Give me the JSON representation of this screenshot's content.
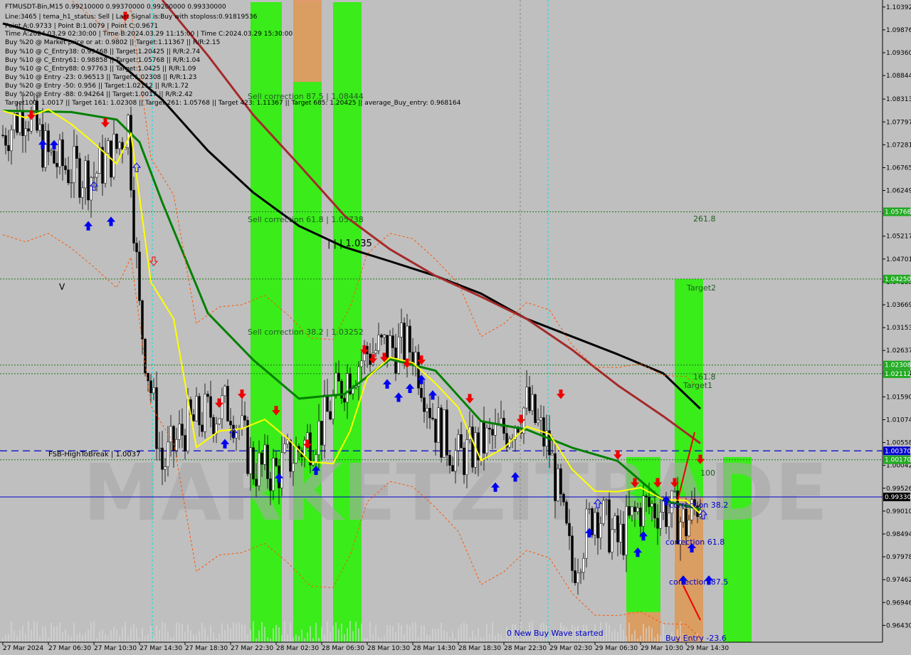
{
  "symbol_header": "FTMUSDT-Bin,M15  0.99210000 0.99370000 0.99200000 0.99330000",
  "info_lines": [
    "Line:3465 | tema_h1_status: Sell | Last Signal is:Buy with stoploss:0.91819536",
    "Point A:0.9733 | Point B:1.0079 | Point C:0.9671",
    "Time A:2024.03.29 02:30:00 | Time B:2024.03.29 11:15:00 | Time C:2024.03.29 15:30:00",
    "Buy %20 @ Market price or at: 0.9802 || Target:1.11367 || R/R:2.15",
    "Buy %10 @ C_Entry38: 0.99468 || Target:1.20425 || R/R:2.74",
    "Buy %10 @ C_Entry61: 0.98858 || Target:1.05768 || R/R:1.04",
    "Buy %10 @ C_Entry88: 0.97763 || Target:1.0425 || R/R:1.09",
    "Buy %10 @ Entry -23: 0.96513 || Target:1.02308 || R/R:1.23",
    "Buy %20 @ Entry -50: 0.956 || Target:1.02112 || R/R:1.72",
    "Buy %20 @ Entry -88: 0.94264 || Target:1.0017 || R/R:2.42",
    "Target100: 1.0017 || Target 161: 1.02308 || Target 261: 1.05768 || Target 423: 1.11367 || Target 685: 1.20425 || average_Buy_entry: 0.968164"
  ],
  "watermark": "MARKETZITRADE",
  "colors": {
    "background": "#bfbfbf",
    "green_zone": "#33ee11",
    "orange_zone": "#e39966",
    "ema_black": "#000000",
    "ema_brown": "#a52a2a",
    "ema_green": "#008000",
    "line_yellow": "#ffff00",
    "envelope_orange": "#ff5500",
    "level_green": "#1a7a1a",
    "level_blue": "#0000cc",
    "arrow_blue": "#0000ee",
    "arrow_red": "#ee0000",
    "tag_green": "#22aa22",
    "tag_blue": "#0000cc",
    "tag_black": "#000000",
    "cyan_line": "#00e5e5"
  },
  "annotations": {
    "sell_875": "Sell correction 87.5 | 1.08444",
    "sell_618": "Sell correction 61.8 | 1.05738",
    "sell_382": "Sell correction 38.2 | 1.03252",
    "level_1035": "| | | 1.035",
    "fib_2618": "261.8",
    "target2": "Target2",
    "fib_1618": "161.8",
    "target1": "Target1",
    "fsb": "FSB-HighToBreak | 1.0037",
    "fib_100": "100",
    "corr_382": "correction 38.2",
    "corr_618": "correction 61.8",
    "corr_875": "correction 87.5",
    "new_wave": "0 New Buy Wave started",
    "buy_entry": "Buy Entry -23.6",
    "v_mark": "V"
  },
  "chart_data": {
    "type": "candlestick",
    "title": "FTMUSDT-Bin,M15",
    "ylim": [
      0.9605,
      1.1055
    ],
    "yaxis_ticks": [
      "1.10392",
      "1.09876",
      "1.09360",
      "1.08844",
      "1.08313",
      "1.07797",
      "1.07281",
      "1.06765",
      "1.06249",
      "1.05733",
      "1.05217",
      "1.04701",
      "1.04185",
      "1.03669",
      "1.03153",
      "1.02637",
      "1.02121",
      "1.01590",
      "1.01074",
      "1.00558",
      "1.00042",
      "0.99526",
      "0.99010",
      "0.98494",
      "0.97978",
      "0.97462",
      "0.96946",
      "0.96430"
    ],
    "xaxis_ticks": [
      "27 Mar 2024",
      "27 Mar 06:30",
      "27 Mar 10:30",
      "27 Mar 14:30",
      "27 Mar 18:30",
      "27 Mar 22:30",
      "28 Mar 02:30",
      "28 Mar 06:30",
      "28 Mar 10:30",
      "28 Mar 14:30",
      "28 Mar 18:30",
      "28 Mar 22:30",
      "29 Mar 02:30",
      "29 Mar 06:30",
      "29 Mar 10:30",
      "29 Mar 14:30"
    ],
    "price_tags": [
      {
        "label": "1.05768",
        "value": 1.05768,
        "color": "green"
      },
      {
        "label": "1.04250",
        "value": 1.0425,
        "color": "green"
      },
      {
        "label": "1.02308",
        "value": 1.02308,
        "color": "green"
      },
      {
        "label": "1.02112",
        "value": 1.02112,
        "color": "green"
      },
      {
        "label": "1.00370",
        "value": 1.0037,
        "color": "blue"
      },
      {
        "label": "1.00170",
        "value": 1.0017,
        "color": "green"
      },
      {
        "label": "0.99330",
        "value": 0.9933,
        "color": "black"
      }
    ],
    "horizontal_levels": [
      {
        "value": 1.05768,
        "style": "dotted",
        "color": "green"
      },
      {
        "value": 1.0425,
        "style": "dotted",
        "color": "green"
      },
      {
        "value": 1.02308,
        "style": "dotted",
        "color": "green"
      },
      {
        "value": 1.02112,
        "style": "dotted",
        "color": "green"
      },
      {
        "value": 1.0037,
        "style": "dashed",
        "color": "blue"
      },
      {
        "value": 1.0017,
        "style": "dotted",
        "color": "green"
      },
      {
        "value": 0.9933,
        "style": "solid",
        "color": "blue"
      }
    ],
    "zones": [
      {
        "x_start": "27 Mar 21:45",
        "x_end": "28 Mar 00:30",
        "color": "green"
      },
      {
        "x_start": "28 Mar 01:30",
        "x_end": "28 Mar 04:00",
        "color": "green"
      },
      {
        "x_start": "28 Mar 05:00",
        "x_end": "28 Mar 07:30",
        "color": "green"
      },
      {
        "x_start": "28 Mar 01:30",
        "x_end": "28 Mar 04:00",
        "color": "orange",
        "top": 1.1055,
        "bottom": 1.087
      },
      {
        "x_start": "29 Mar 06:45",
        "x_end": "29 Mar 09:45",
        "color": "green",
        "top": 1.0023,
        "bottom": 0.9605
      },
      {
        "x_start": "29 Mar 06:45",
        "x_end": "29 Mar 09:45",
        "color": "orange",
        "top": 0.9673,
        "bottom": 0.9605
      },
      {
        "x_start": "29 Mar 11:00",
        "x_end": "29 Mar 13:30",
        "color": "green",
        "top": 1.0425,
        "bottom": 0.9605
      },
      {
        "x_start": "29 Mar 11:00",
        "x_end": "29 Mar 13:30",
        "color": "orange",
        "top": 0.9933,
        "bottom": 0.9605
      },
      {
        "x_start": "29 Mar 15:15",
        "x_end": "29 Mar 17:45",
        "color": "green",
        "top": 1.0023,
        "bottom": 0.9605
      }
    ],
    "series": [
      {
        "name": "ema_black",
        "color": "black",
        "points": [
          [
            "27 Mar 00:00",
            1.1002
          ],
          [
            "27 Mar 06:00",
            1.0962
          ],
          [
            "27 Mar 10:00",
            1.0918
          ],
          [
            "27 Mar 14:00",
            1.083
          ],
          [
            "27 Mar 18:00",
            1.0715
          ],
          [
            "27 Mar 22:00",
            1.062
          ],
          [
            "28 Mar 02:00",
            1.0545
          ],
          [
            "28 Mar 06:00",
            1.0497
          ],
          [
            "28 Mar 10:00",
            1.0465
          ],
          [
            "28 Mar 14:00",
            1.0432
          ],
          [
            "28 Mar 18:00",
            1.0392
          ],
          [
            "28 Mar 22:00",
            1.0335
          ],
          [
            "29 Mar 02:00",
            1.0295
          ],
          [
            "29 Mar 06:00",
            1.0255
          ],
          [
            "29 Mar 10:00",
            1.0212
          ],
          [
            "29 Mar 13:15",
            1.0132
          ]
        ]
      },
      {
        "name": "ema_brown",
        "color": "brown",
        "points": [
          [
            "27 Mar 14:00",
            1.1055
          ],
          [
            "27 Mar 18:00",
            1.093
          ],
          [
            "27 Mar 22:00",
            1.0795
          ],
          [
            "28 Mar 02:00",
            1.0683
          ],
          [
            "28 Mar 06:00",
            1.0568
          ],
          [
            "28 Mar 10:00",
            1.0492
          ],
          [
            "28 Mar 14:00",
            1.0432
          ],
          [
            "28 Mar 18:00",
            1.0385
          ],
          [
            "28 Mar 22:00",
            1.0335
          ],
          [
            "29 Mar 02:00",
            1.0265
          ],
          [
            "29 Mar 06:00",
            1.0185
          ],
          [
            "29 Mar 10:00",
            1.0115
          ],
          [
            "29 Mar 13:15",
            1.0054
          ]
        ]
      },
      {
        "name": "ema_green",
        "color": "green",
        "points": [
          [
            "27 Mar 00:00",
            1.0805
          ],
          [
            "27 Mar 06:00",
            1.0802
          ],
          [
            "27 Mar 10:00",
            1.0785
          ],
          [
            "27 Mar 12:00",
            1.0734
          ],
          [
            "27 Mar 14:00",
            1.0598
          ],
          [
            "27 Mar 18:00",
            1.0348
          ],
          [
            "27 Mar 22:00",
            1.0242
          ],
          [
            "28 Mar 02:00",
            1.0155
          ],
          [
            "28 Mar 06:00",
            1.0165
          ],
          [
            "28 Mar 10:00",
            1.0244
          ],
          [
            "28 Mar 14:00",
            1.0218
          ],
          [
            "28 Mar 18:00",
            1.0104
          ],
          [
            "28 Mar 22:00",
            1.0085
          ],
          [
            "29 Mar 02:00",
            1.0044
          ],
          [
            "29 Mar 06:00",
            1.0014
          ],
          [
            "29 Mar 10:00",
            0.9925
          ],
          [
            "29 Mar 13:15",
            0.9905
          ]
        ]
      },
      {
        "name": "yellow_line",
        "color": "yellow",
        "points": [
          [
            "27 Mar 00:00",
            1.0805
          ],
          [
            "27 Mar 02:00",
            1.0789
          ],
          [
            "27 Mar 04:00",
            1.0808
          ],
          [
            "27 Mar 06:00",
            1.0775
          ],
          [
            "27 Mar 08:00",
            1.0732
          ],
          [
            "27 Mar 10:00",
            1.0685
          ],
          [
            "27 Mar 11:15",
            1.0754
          ],
          [
            "27 Mar 13:00",
            1.0418
          ],
          [
            "27 Mar 15:00",
            1.0335
          ],
          [
            "27 Mar 17:00",
            1.0045
          ],
          [
            "27 Mar 19:00",
            1.0082
          ],
          [
            "27 Mar 21:00",
            1.0087
          ],
          [
            "27 Mar 23:00",
            1.0108
          ],
          [
            "28 Mar 01:00",
            1.0065
          ],
          [
            "28 Mar 03:00",
            1.0012
          ],
          [
            "28 Mar 05:00",
            1.0008
          ],
          [
            "28 Mar 06:30",
            1.0082
          ],
          [
            "28 Mar 08:00",
            1.0202
          ],
          [
            "28 Mar 10:00",
            1.0248
          ],
          [
            "28 Mar 12:00",
            1.0236
          ],
          [
            "28 Mar 14:00",
            1.0189
          ],
          [
            "28 Mar 16:00",
            1.0135
          ],
          [
            "28 Mar 18:00",
            1.0015
          ],
          [
            "28 Mar 20:00",
            1.0044
          ],
          [
            "28 Mar 22:00",
            1.0092
          ],
          [
            "29 Mar 00:00",
            1.0075
          ],
          [
            "29 Mar 02:00",
            0.9995
          ],
          [
            "29 Mar 04:00",
            0.9946
          ],
          [
            "29 Mar 06:00",
            0.9945
          ],
          [
            "29 Mar 08:00",
            0.9954
          ],
          [
            "29 Mar 10:00",
            0.9927
          ],
          [
            "29 Mar 12:00",
            0.9925
          ],
          [
            "29 Mar 13:15",
            0.9895
          ]
        ]
      },
      {
        "name": "candles_close",
        "color": "black",
        "points": [
          [
            "27 Mar 00:00",
            1.075
          ],
          [
            "27 Mar 02:00",
            1.081
          ],
          [
            "27 Mar 04:00",
            1.07
          ],
          [
            "27 Mar 06:00",
            1.067
          ],
          [
            "27 Mar 08:00",
            1.066
          ],
          [
            "27 Mar 10:00",
            1.072
          ],
          [
            "27 Mar 11:00",
            1.078
          ],
          [
            "27 Mar 12:00",
            1.035
          ],
          [
            "27 Mar 14:00",
            1.0
          ],
          [
            "27 Mar 16:00",
            1.009
          ],
          [
            "27 Mar 18:00",
            1.012
          ],
          [
            "27 Mar 20:00",
            1.014
          ],
          [
            "27 Mar 22:00",
            1.0
          ],
          [
            "28 Mar 00:00",
            0.999
          ],
          [
            "28 Mar 02:00",
            1.004
          ],
          [
            "28 Mar 04:00",
            1.009
          ],
          [
            "28 Mar 06:00",
            1.02
          ],
          [
            "28 Mar 08:00",
            1.026
          ],
          [
            "28 Mar 10:00",
            1.027
          ],
          [
            "28 Mar 12:00",
            1.027
          ],
          [
            "28 Mar 14:00",
            1.01
          ],
          [
            "28 Mar 16:00",
            1.002
          ],
          [
            "28 Mar 18:00",
            1.005
          ],
          [
            "28 Mar 20:00",
            1.008
          ],
          [
            "28 Mar 22:00",
            1.014
          ],
          [
            "29 Mar 00:00",
            1.004
          ],
          [
            "29 Mar 02:00",
            0.977
          ],
          [
            "29 Mar 04:00",
            0.991
          ],
          [
            "29 Mar 06:00",
            0.983
          ],
          [
            "29 Mar 08:00",
            0.991
          ],
          [
            "29 Mar 10:00",
            0.991
          ],
          [
            "29 Mar 12:00",
            0.987
          ],
          [
            "29 Mar 13:15",
            0.9933
          ]
        ]
      }
    ],
    "arrows": {
      "up": [
        [
          "27 Mar 03:30",
          1.0729
        ],
        [
          "27 Mar 04:30",
          1.0728
        ],
        [
          "27 Mar 07:30",
          1.0545
        ],
        [
          "27 Mar 09:30",
          1.0555
        ],
        [
          "27 Mar 19:30",
          1.0053
        ],
        [
          "28 Mar 00:15",
          0.9976
        ],
        [
          "28 Mar 03:30",
          0.9993
        ],
        [
          "28 Mar 09:45",
          1.0188
        ],
        [
          "28 Mar 10:45",
          1.0158
        ],
        [
          "28 Mar 11:45",
          1.0178
        ],
        [
          "28 Mar 12:45",
          1.0198
        ],
        [
          "28 Mar 13:45",
          1.0163
        ],
        [
          "28 Mar 19:15",
          0.9955
        ],
        [
          "28 Mar 21:00",
          0.9978
        ],
        [
          "29 Mar 03:30",
          0.9852
        ],
        [
          "29 Mar 07:45",
          0.9808
        ],
        [
          "29 Mar 08:15",
          0.9845
        ],
        [
          "29 Mar 10:15",
          0.9925
        ],
        [
          "29 Mar 11:45",
          0.9745
        ],
        [
          "29 Mar 12:30",
          0.9818
        ],
        [
          "29 Mar 14:00",
          0.9745
        ]
      ],
      "down": [
        [
          "27 Mar 02:30",
          1.0795
        ],
        [
          "27 Mar 09:00",
          1.0778
        ],
        [
          "27 Mar 10:45",
          1.1018
        ],
        [
          "27 Mar 19:00",
          1.0145
        ],
        [
          "27 Mar 21:00",
          1.0165
        ],
        [
          "28 Mar 00:00",
          1.0128
        ],
        [
          "28 Mar 02:45",
          1.0052
        ],
        [
          "28 Mar 07:45",
          1.0265
        ],
        [
          "28 Mar 08:30",
          1.0245
        ],
        [
          "28 Mar 09:30",
          1.0248
        ],
        [
          "28 Mar 11:30",
          1.0235
        ],
        [
          "28 Mar 12:45",
          1.0242
        ],
        [
          "28 Mar 17:00",
          1.0155
        ],
        [
          "28 Mar 21:30",
          1.0108
        ],
        [
          "29 Mar 01:00",
          1.0165
        ],
        [
          "29 Mar 06:00",
          1.0028
        ],
        [
          "29 Mar 07:30",
          0.9965
        ],
        [
          "29 Mar 09:30",
          0.9965
        ],
        [
          "29 Mar 11:00",
          0.9965
        ],
        [
          "29 Mar 13:15",
          1.0018
        ]
      ],
      "hollow_up": [
        [
          "27 Mar 08:00",
          1.0635
        ],
        [
          "27 Mar 11:45",
          1.0677
        ],
        [
          "27 Mar 20:15",
          1.0078
        ],
        [
          "29 Mar 04:15",
          0.9918
        ],
        [
          "29 Mar 13:30",
          0.9893
        ]
      ],
      "hollow_down": [
        [
          "27 Mar 13:15",
          1.0465
        ]
      ]
    },
    "grid": false,
    "legend": "none"
  }
}
